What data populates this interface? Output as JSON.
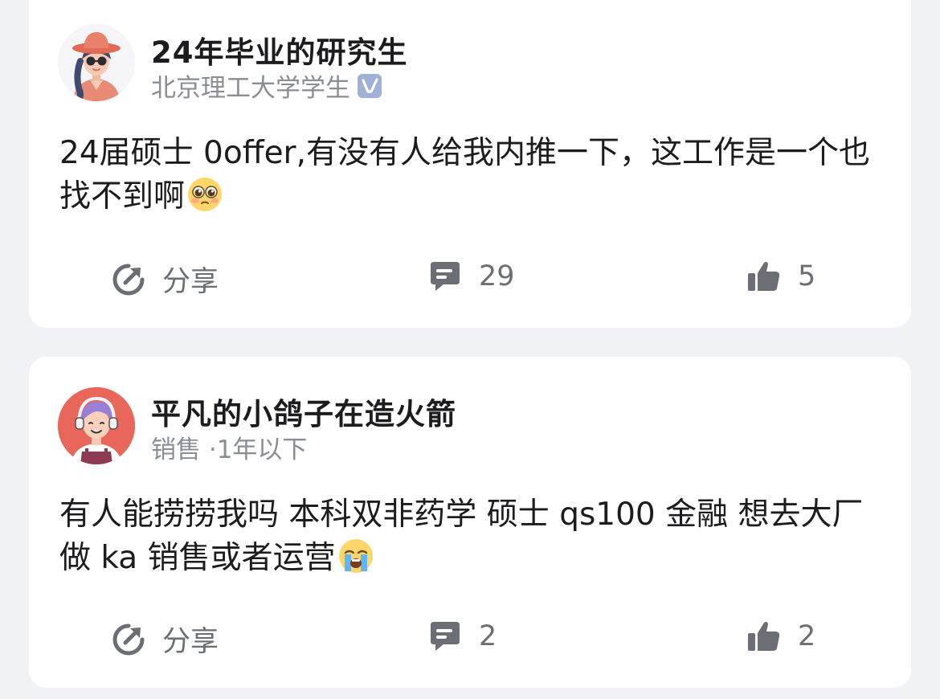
{
  "colors": {
    "background": "#f1f2f6",
    "card": "#ffffff",
    "text_primary": "#1c1c1e",
    "text_secondary": "#8a8d95",
    "action_gray": "#6b6e75",
    "verified_badge": "#9fb1d6"
  },
  "posts": [
    {
      "author": {
        "name": "24年毕业的研究生",
        "subtitle": "北京理工大学学生",
        "verified": true,
        "avatar": "avatar-girl-sunglasses"
      },
      "content": "24届硕士 0offer,有没有人给我内推一下，这工作是一个也找不到啊",
      "content_emoji": "pleading-face-emoji",
      "actions": {
        "share_label": "分享",
        "comment_count": "29",
        "like_count": "5"
      }
    },
    {
      "author": {
        "name": "平凡的小鸽子在造火箭",
        "subtitle": "销售 ·1年以下",
        "verified": false,
        "avatar": "avatar-headphones-purple-hair"
      },
      "content": "有人能捞捞我吗 本科双非药学 硕士 qs100 金融 想去大厂做 ka 销售或者运营",
      "content_emoji": "loudly-crying-face-emoji",
      "actions": {
        "share_label": "分享",
        "comment_count": "2",
        "like_count": "2"
      }
    }
  ]
}
